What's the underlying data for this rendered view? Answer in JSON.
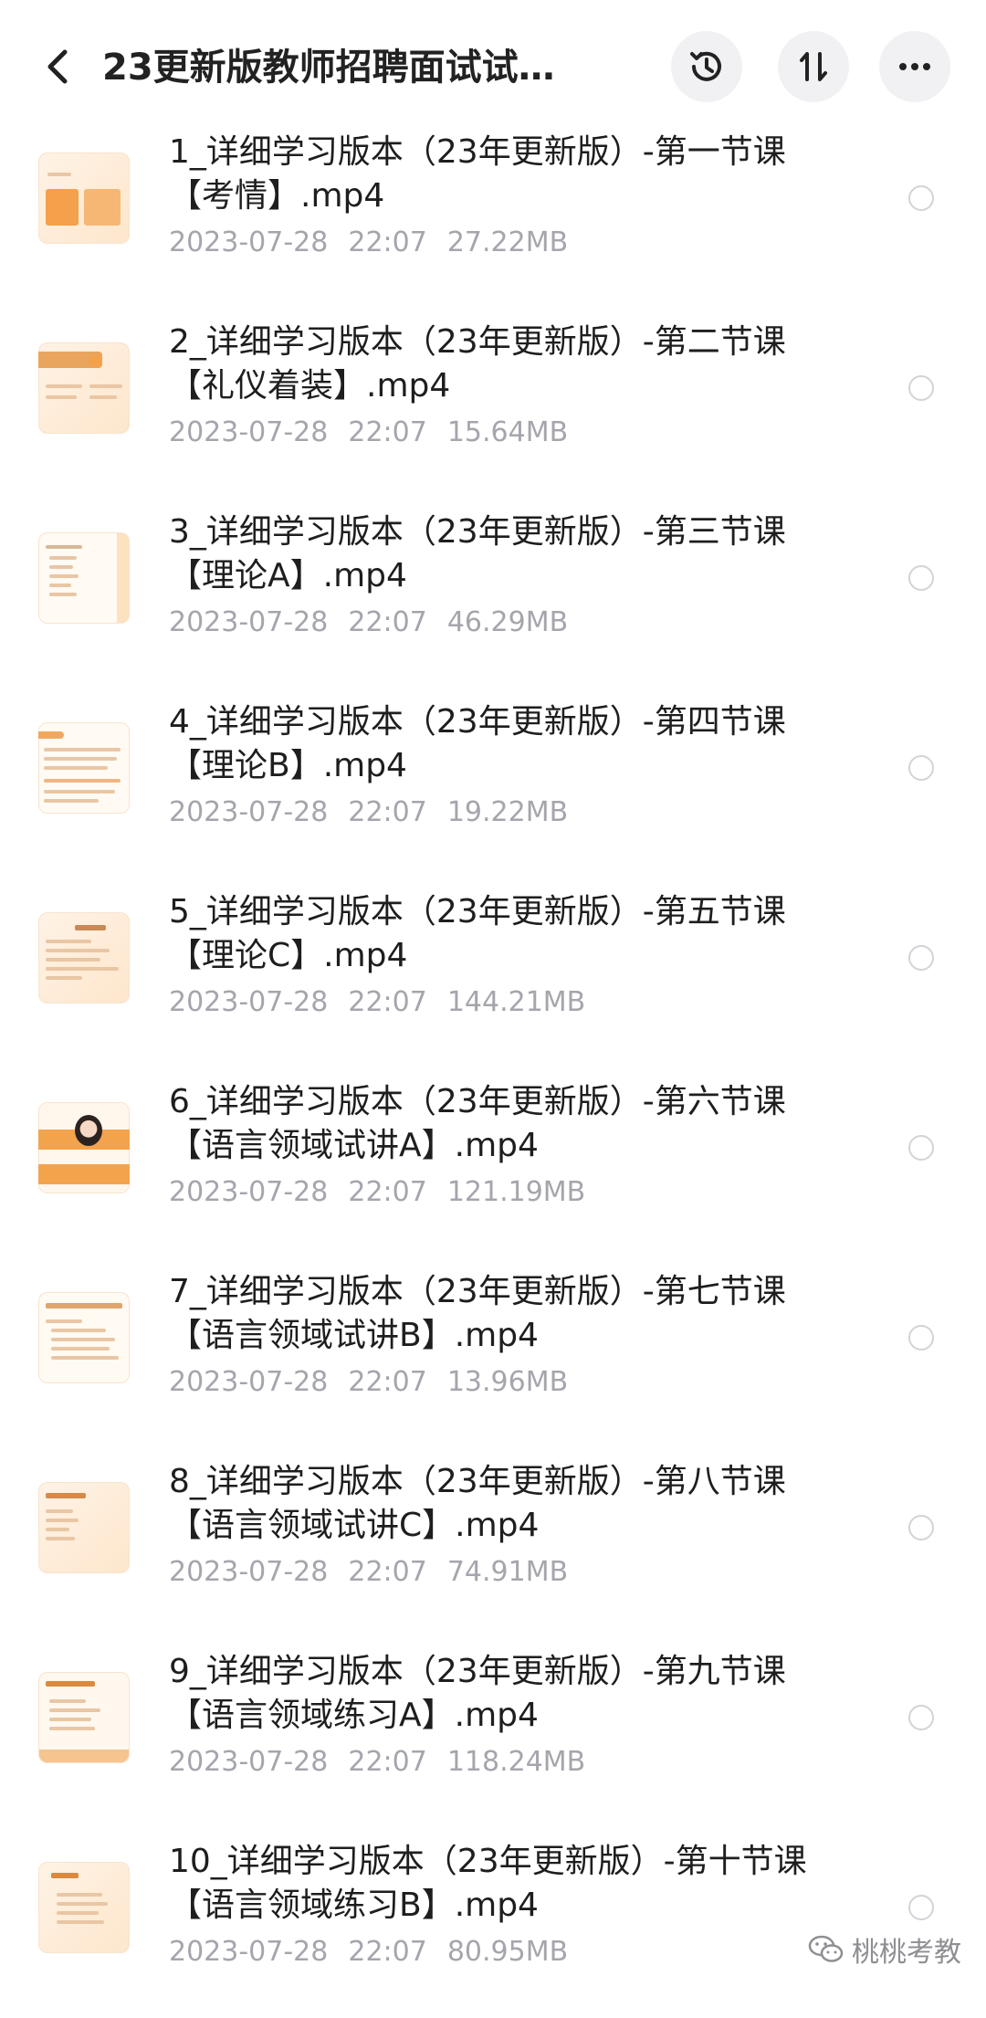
{
  "header": {
    "title": "23更新版教师招聘面试试…",
    "back_icon": "chevron-left-icon",
    "actions": [
      "history-icon",
      "sort-icon",
      "more-icon"
    ]
  },
  "files": [
    {
      "name_line1": "1_详细学习版本（23年更新版）-第一节课",
      "name_line2": "【考情】.mp4",
      "date": "2023-07-28",
      "time": "22:07",
      "size": "27.22MB"
    },
    {
      "name_line1": "2_详细学习版本（23年更新版）-第二节课",
      "name_line2": "【礼仪着装】.mp4",
      "date": "2023-07-28",
      "time": "22:07",
      "size": "15.64MB"
    },
    {
      "name_line1": "3_详细学习版本（23年更新版）-第三节课",
      "name_line2": "【理论A】.mp4",
      "date": "2023-07-28",
      "time": "22:07",
      "size": "46.29MB"
    },
    {
      "name_line1": "4_详细学习版本（23年更新版）-第四节课",
      "name_line2": "【理论B】.mp4",
      "date": "2023-07-28",
      "time": "22:07",
      "size": "19.22MB"
    },
    {
      "name_line1": "5_详细学习版本（23年更新版）-第五节课",
      "name_line2": "【理论C】.mp4",
      "date": "2023-07-28",
      "time": "22:07",
      "size": "144.21MB"
    },
    {
      "name_line1": "6_详细学习版本（23年更新版）-第六节课",
      "name_line2": "【语言领域试讲A】.mp4",
      "date": "2023-07-28",
      "time": "22:07",
      "size": "121.19MB"
    },
    {
      "name_line1": "7_详细学习版本（23年更新版）-第七节课",
      "name_line2": "【语言领域试讲B】.mp4",
      "date": "2023-07-28",
      "time": "22:07",
      "size": "13.96MB"
    },
    {
      "name_line1": "8_详细学习版本（23年更新版）-第八节课",
      "name_line2": "【语言领域试讲C】.mp4",
      "date": "2023-07-28",
      "time": "22:07",
      "size": "74.91MB"
    },
    {
      "name_line1": "9_详细学习版本（23年更新版）-第九节课",
      "name_line2": "【语言领域练习A】.mp4",
      "date": "2023-07-28",
      "time": "22:07",
      "size": "118.24MB"
    },
    {
      "name_line1": "10_详细学习版本（23年更新版）-第十节课",
      "name_line2": "【语言领域练习B】.mp4",
      "date": "2023-07-28",
      "time": "22:07",
      "size": "80.95MB"
    }
  ],
  "watermark": {
    "text": "桃桃考教",
    "icon": "wechat-icon"
  }
}
